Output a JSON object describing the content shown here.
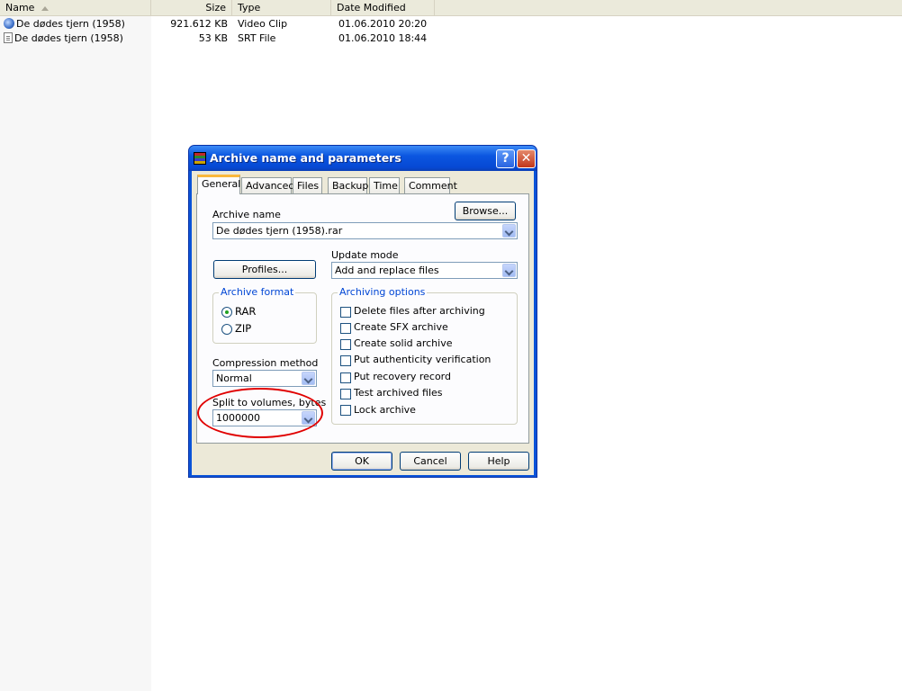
{
  "explorer": {
    "columns": {
      "name": "Name",
      "size": "Size",
      "type": "Type",
      "date": "Date Modified"
    },
    "files": [
      {
        "name": "De dødes tjern (1958)",
        "size": "921.612 KB",
        "type": "Video Clip",
        "date": "01.06.2010 20:20",
        "icon": "video-clip-icon"
      },
      {
        "name": "De dødes tjern (1958)",
        "size": "53 KB",
        "type": "SRT File",
        "date": "01.06.2010 18:44",
        "icon": "text-file-icon"
      }
    ]
  },
  "dialog": {
    "title": "Archive name and parameters",
    "help_glyph": "?",
    "close_glyph": "✕",
    "tabs": [
      "General",
      "Advanced",
      "Files",
      "Backup",
      "Time",
      "Comment"
    ],
    "active_tab": "General",
    "browse_label": "Browse...",
    "archive_name_label": "Archive name",
    "archive_name_value": "De dødes tjern (1958).rar",
    "update_mode_label": "Update mode",
    "update_mode_value": "Add and replace files",
    "profiles_label": "Profiles...",
    "archive_format": {
      "caption": "Archive format",
      "options": [
        "RAR",
        "ZIP"
      ],
      "selected": "RAR"
    },
    "archiving_options": {
      "caption": "Archiving options",
      "items": [
        "Delete files after archiving",
        "Create SFX archive",
        "Create solid archive",
        "Put authenticity verification",
        "Put recovery record",
        "Test archived files",
        "Lock archive"
      ]
    },
    "compression_label": "Compression method",
    "compression_value": "Normal",
    "split_label": "Split to volumes, bytes",
    "split_value": "1000000",
    "buttons": {
      "ok": "OK",
      "cancel": "Cancel",
      "help": "Help"
    },
    "highlight_color": "#e00000"
  }
}
